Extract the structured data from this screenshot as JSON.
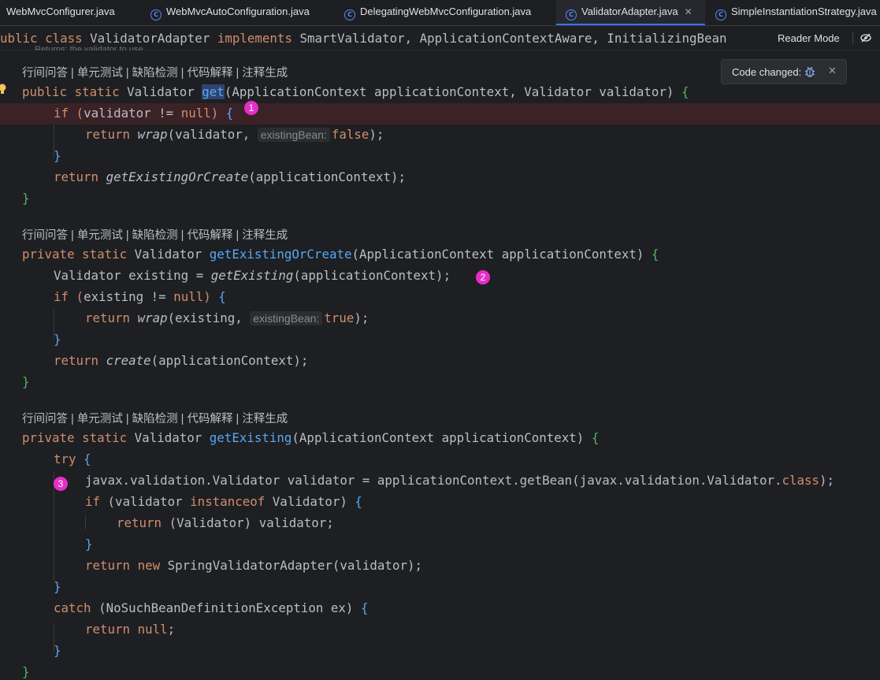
{
  "tabs": [
    {
      "label": "WebMvcConfigurer.java",
      "active": false
    },
    {
      "label": "WebMvcAutoConfiguration.java",
      "active": false
    },
    {
      "label": "DelegatingWebMvcConfiguration.java",
      "active": false
    },
    {
      "label": "ValidatorAdapter.java",
      "active": true
    },
    {
      "label": "SimpleInstantiationStrategy.java",
      "active": false
    }
  ],
  "sticky_header": {
    "p1": "ublic ",
    "p2": "class ",
    "p3": "ValidatorAdapter ",
    "p4": "implements ",
    "p5": "SmartValidator, ApplicationContextAware, InitializingBean",
    "doc_remnant": "Returns: the validator to use"
  },
  "reader_mode": {
    "label": "Reader Mode"
  },
  "toast": {
    "label": "Code changed:"
  },
  "hints": {
    "ai_actions": "行间问答 | 单元测试 | 缺陷检测 | 代码解释 | 注释生成"
  },
  "inlay_hints": {
    "existing_bean": "existingBean:"
  },
  "markers": [
    "1",
    "2",
    "3"
  ],
  "colors": {
    "background": "#1e1f22",
    "keyword": "#cf8e6d",
    "method": "#56a8f5",
    "marker": "#e62ec8",
    "breakpoint_line": "#3b2226",
    "accent": "#3574f0"
  },
  "code": {
    "l1": {
      "a": "public ",
      "b": "static ",
      "c": "Validator ",
      "d": "get",
      "e": "(ApplicationContext applicationContext, Validator validator) ",
      "f": "{"
    },
    "l2": {
      "a": "if ",
      "b": "(",
      "c": "validator != ",
      "d": "null",
      "e": ") ",
      "f": "{"
    },
    "l3": {
      "a": "return ",
      "b": "wrap",
      "c": "(validator, ",
      "d": "false",
      "e": ");"
    },
    "l4": {
      "a": "}"
    },
    "l5": {
      "a": "return ",
      "b": "getExistingOrCreate",
      "c": "(applicationContext);"
    },
    "l6": {
      "a": "}"
    },
    "l7": {
      "a": "private ",
      "b": "static ",
      "c": "Validator ",
      "d": "getExistingOrCreate",
      "e": "(ApplicationContext applicationContext) ",
      "f": "{"
    },
    "l8": {
      "a": "Validator existing = ",
      "b": "getExisting",
      "c": "(applicationContext);"
    },
    "l9": {
      "a": "if ",
      "b": "(",
      "c": "existing != ",
      "d": "null",
      "e": ") ",
      "f": "{"
    },
    "l10": {
      "a": "return ",
      "b": "wrap",
      "c": "(existing, ",
      "d": "true",
      "e": ");"
    },
    "l11": {
      "a": "}"
    },
    "l12": {
      "a": "return ",
      "b": "create",
      "c": "(applicationContext);"
    },
    "l13": {
      "a": "}"
    },
    "l14": {
      "a": "private ",
      "b": "static ",
      "c": "Validator ",
      "d": "getExisting",
      "e": "(ApplicationContext applicationContext) ",
      "f": "{"
    },
    "l15": {
      "a": "try ",
      "b": "{"
    },
    "l16": {
      "a": "javax.validation.Validator validator = applicationContext.getBean(javax.validation.Validator.",
      "b": "class",
      "c": ");"
    },
    "l17": {
      "a": "if ",
      "b": "(validator ",
      "c": "instanceof ",
      "d": "Validator) ",
      "e": "{"
    },
    "l18": {
      "a": "return ",
      "b": "(Validator) validator;"
    },
    "l19": {
      "a": "}"
    },
    "l20": {
      "a": "return ",
      "b": "new ",
      "c": "SpringValidatorAdapter(validator);"
    },
    "l21": {
      "a": "}"
    },
    "l22": {
      "a": "catch ",
      "b": "(NoSuchBeanDefinitionException ex) ",
      "c": "{"
    },
    "l23": {
      "a": "return ",
      "b": "null",
      "c": ";"
    },
    "l24": {
      "a": "}"
    },
    "l25": {
      "a": "}"
    }
  }
}
